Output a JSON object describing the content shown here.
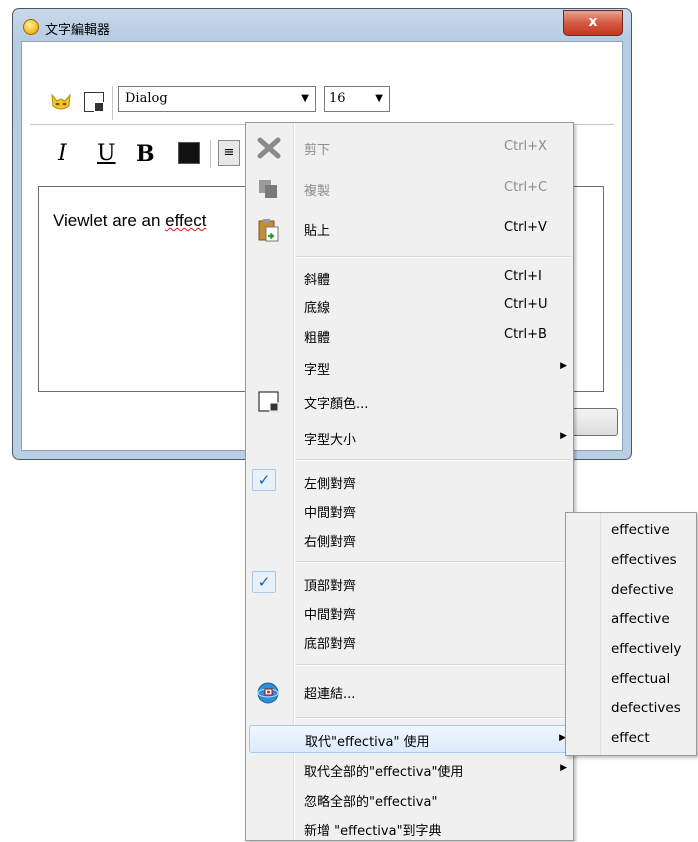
{
  "window": {
    "title": "文字編輯器",
    "close_label": "x"
  },
  "toolbar": {
    "font_name": "Dialog",
    "font_size": "16",
    "italic_label": "I",
    "underline_label": "U",
    "bold_label": "B",
    "align_label": "≡",
    "color_value": "#111111"
  },
  "editor": {
    "text_plain": "Viewlet are an ",
    "text_misspelled": "effect"
  },
  "menu": {
    "cut": {
      "label": "剪下",
      "shortcut": "Ctrl+X"
    },
    "copy": {
      "label": "複製",
      "shortcut": "Ctrl+C"
    },
    "paste": {
      "label": "貼上",
      "shortcut": "Ctrl+V"
    },
    "italic": {
      "label": "斜體",
      "shortcut": "Ctrl+I"
    },
    "underline": {
      "label": "底線",
      "shortcut": "Ctrl+U"
    },
    "bold": {
      "label": "粗體",
      "shortcut": "Ctrl+B"
    },
    "font": {
      "label": "字型"
    },
    "text_color": {
      "label": "文字顏色..."
    },
    "font_size": {
      "label": "字型大小"
    },
    "align_left": {
      "label": "左側對齊",
      "checked": true
    },
    "align_center": {
      "label": "中間對齊"
    },
    "align_right": {
      "label": "右側對齊"
    },
    "align_top": {
      "label": "頂部對齊",
      "checked": true
    },
    "align_middle": {
      "label": "中間對齊"
    },
    "align_bottom": {
      "label": "底部對齊"
    },
    "hyperlink": {
      "label": "超連結..."
    },
    "replace": {
      "label": "取代\"effectiva\" 使用"
    },
    "replace_all": {
      "label": "取代全部的\"effectiva\"使用"
    },
    "ignore_all": {
      "label": "忽略全部的\"effectiva\""
    },
    "add_dictionary": {
      "label": "新增 \"effectiva\"到字典"
    }
  },
  "suggestions": [
    "effective",
    "effectives",
    "defective",
    "affective",
    "effectively",
    "effectual",
    "defectives",
    "effect"
  ]
}
